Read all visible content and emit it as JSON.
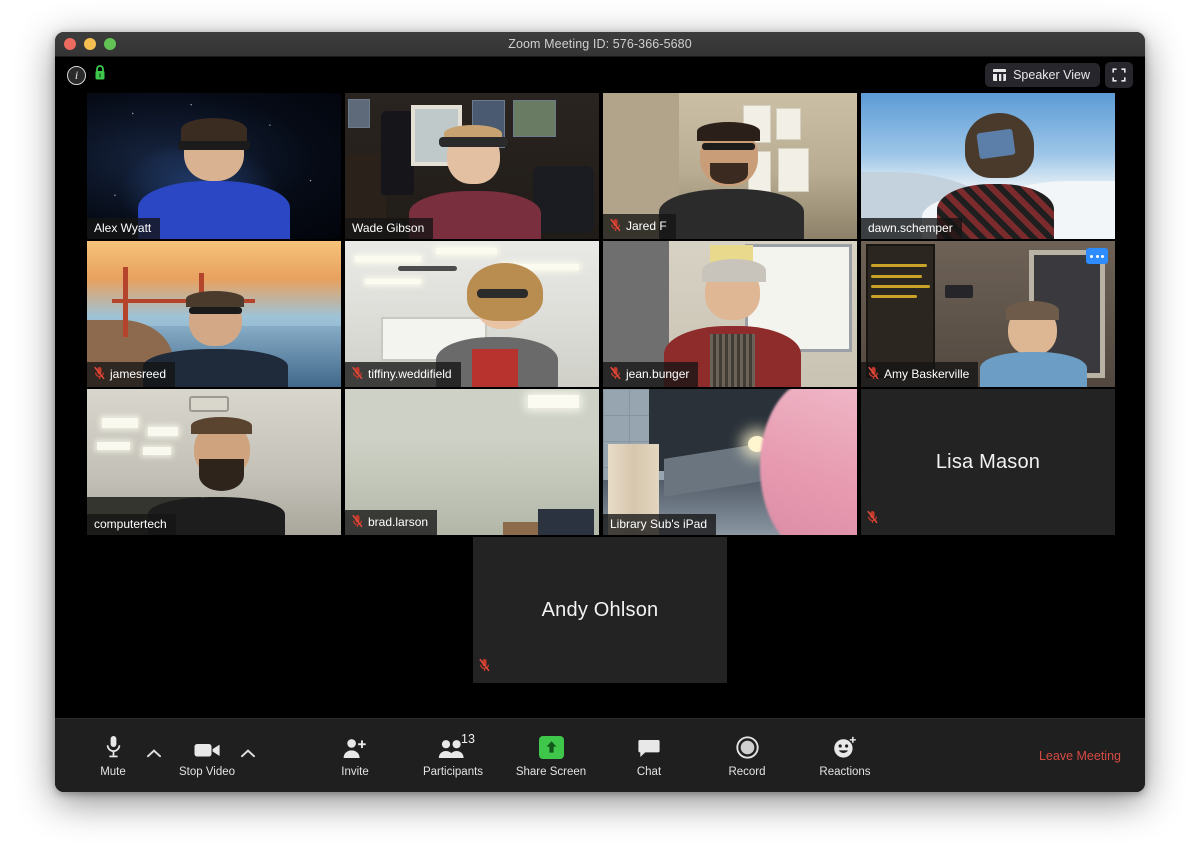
{
  "window": {
    "title": "Zoom Meeting ID: 576-366-5680",
    "traffic": {
      "close": "close",
      "minimize": "minimize",
      "maximize": "maximize"
    }
  },
  "topbar": {
    "info_glyph": "i",
    "lock_name": "encryption-lock-icon",
    "view_label": "Speaker View",
    "fullscreen_name": "enter-fullscreen-icon"
  },
  "participants_grid": {
    "rows": [
      [
        {
          "name": "Alex Wyatt",
          "muted": false,
          "video": true,
          "scene": "sc-alex",
          "active": false,
          "more": false
        },
        {
          "name": "Wade Gibson",
          "muted": false,
          "video": true,
          "scene": "sc-wade",
          "active": false,
          "more": false
        },
        {
          "name": "Jared F",
          "muted": true,
          "video": true,
          "scene": "sc-jared",
          "active": false,
          "more": false
        },
        {
          "name": "dawn.schemper",
          "muted": false,
          "video": true,
          "scene": "sc-dawn",
          "active": false,
          "more": false
        }
      ],
      [
        {
          "name": "jamesreed",
          "muted": true,
          "video": true,
          "scene": "sc-james",
          "active": false,
          "more": false
        },
        {
          "name": "tiffiny.weddifield",
          "muted": true,
          "video": true,
          "scene": "sc-tiff",
          "active": false,
          "more": false
        },
        {
          "name": "jean.bunger",
          "muted": true,
          "video": true,
          "scene": "sc-jean",
          "active": false,
          "more": false
        },
        {
          "name": "Amy Baskerville",
          "muted": true,
          "video": true,
          "scene": "sc-amy",
          "active": false,
          "more": true
        }
      ],
      [
        {
          "name": "computertech",
          "muted": false,
          "video": true,
          "scene": "sc-ct",
          "active": false,
          "more": false
        },
        {
          "name": "brad.larson",
          "muted": true,
          "video": true,
          "scene": "sc-brad",
          "active": false,
          "more": false
        },
        {
          "name": "Library Sub's iPad",
          "muted": false,
          "video": true,
          "scene": "sc-lib",
          "active": true,
          "more": false
        },
        {
          "name": "Lisa Mason",
          "muted": true,
          "video": false,
          "scene": "",
          "active": false,
          "more": false
        }
      ],
      [
        {
          "name": "Andy Ohlson",
          "muted": true,
          "video": false,
          "scene": "",
          "active": false,
          "more": false
        }
      ]
    ]
  },
  "toolbar": {
    "mute_label": "Mute",
    "mute_icon": "microphone-icon",
    "mute_chevron": "chevron-up-icon",
    "video_label": "Stop Video",
    "video_icon": "camera-icon",
    "video_chevron": "chevron-up-icon",
    "invite_label": "Invite",
    "invite_icon": "person-plus-icon",
    "participants_label": "Participants",
    "participants_icon": "people-icon",
    "participants_count": "13",
    "share_label": "Share Screen",
    "share_icon": "share-arrow-up-icon",
    "chat_label": "Chat",
    "chat_icon": "speech-bubble-icon",
    "record_label": "Record",
    "record_icon": "record-circle-icon",
    "reactions_label": "Reactions",
    "reactions_icon": "smiley-face-icon",
    "leave_label": "Leave Meeting"
  },
  "colors": {
    "accent_blue": "#2d8cff",
    "share_green": "#3ec74a",
    "active_speaker": "#d8e04a",
    "leave_red": "#d64a44",
    "muted_red": "#c0392b"
  }
}
